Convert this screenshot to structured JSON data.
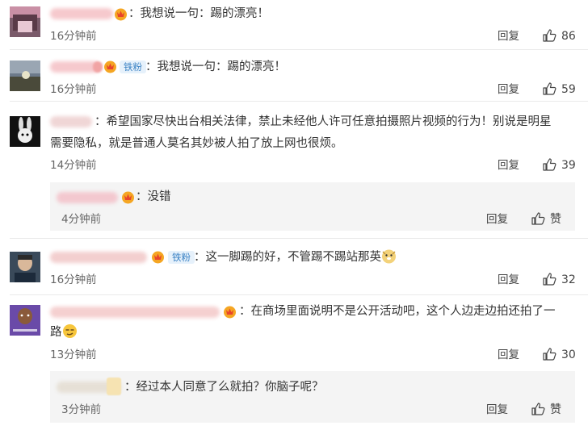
{
  "ui": {
    "reply_label": "回复",
    "like_zero_label": "赞",
    "fan_label": "铁粉"
  },
  "comments": [
    {
      "text": "：我想说一句：踢的漂亮！",
      "time": "16分钟前",
      "likes": "86"
    },
    {
      "text": "：我想说一句：踢的漂亮！",
      "time": "16分钟前",
      "likes": "59"
    },
    {
      "text_line1": "：希望国家尽快出台相关法律，禁止未经他人许可任意拍摄照片视频的行为！别说是明星",
      "text_line2": "需要隐私，就是普通人莫名其妙被人拍了放上网也很烦。",
      "time": "14分钟前",
      "likes": "39",
      "reply": {
        "text": "：没错",
        "time": "4分钟前"
      }
    },
    {
      "text": "：这一脚踢的好，不管踢不踢站那英",
      "time": "16分钟前",
      "likes": "32"
    },
    {
      "text_line1": "：在商场里面说明不是公开活动吧，这个人边走边拍还拍了一",
      "text_line2": "路",
      "time": "13分钟前",
      "likes": "30",
      "reply": {
        "text": "：经过本人同意了么就拍？你脑子呢？",
        "time": "3分钟前"
      }
    }
  ],
  "icons": {
    "vip_badge": "crown-vip-badge-icon",
    "like": "thumbs-up-icon",
    "emoji_doge": "doge-emoji-icon",
    "emoji_smirk": "smirk-emoji-icon"
  }
}
